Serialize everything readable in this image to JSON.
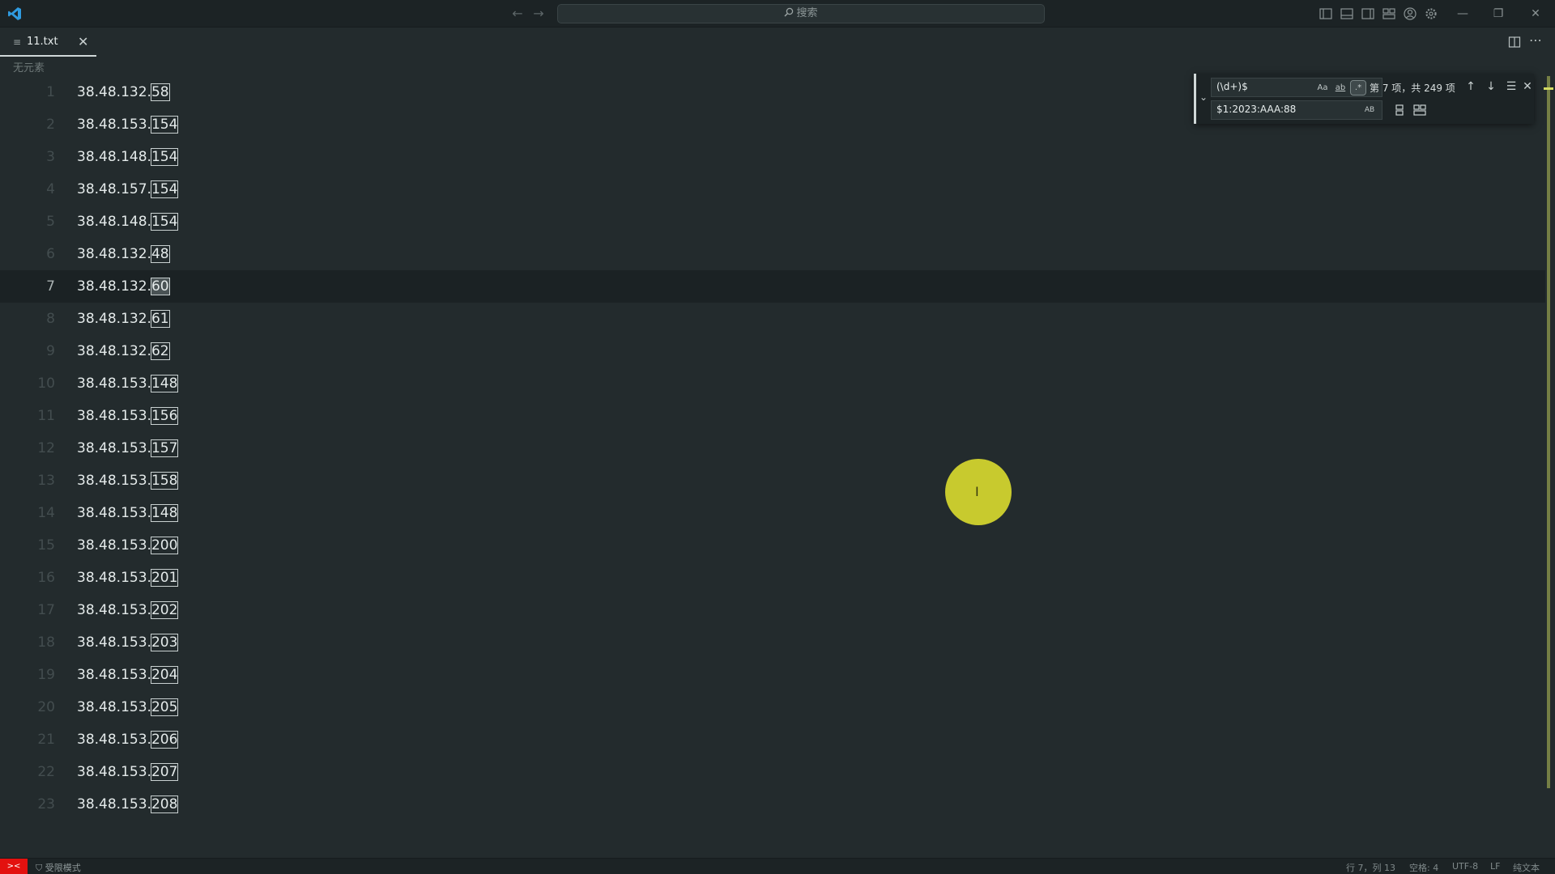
{
  "titlebar": {
    "search_placeholder": "搜索",
    "back": "←",
    "forward": "→",
    "minimize": "—",
    "restore": "❐",
    "close": "✕"
  },
  "tab": {
    "label": "11.txt",
    "close": "✕",
    "icon": "≡"
  },
  "breadcrumb": "无元素",
  "lines": [
    {
      "n": "1",
      "pre": "38.48.132.",
      "match": "58"
    },
    {
      "n": "2",
      "pre": "38.48.153.",
      "match": "154"
    },
    {
      "n": "3",
      "pre": "38.48.148.",
      "match": "154"
    },
    {
      "n": "4",
      "pre": "38.48.157.",
      "match": "154"
    },
    {
      "n": "5",
      "pre": "38.48.148.",
      "match": "154"
    },
    {
      "n": "6",
      "pre": "38.48.132.",
      "match": "48"
    },
    {
      "n": "7",
      "pre": "38.48.132.",
      "match": "60"
    },
    {
      "n": "8",
      "pre": "38.48.132.",
      "match": "61"
    },
    {
      "n": "9",
      "pre": "38.48.132.",
      "match": "62"
    },
    {
      "n": "10",
      "pre": "38.48.153.",
      "match": "148"
    },
    {
      "n": "11",
      "pre": "38.48.153.",
      "match": "156"
    },
    {
      "n": "12",
      "pre": "38.48.153.",
      "match": "157"
    },
    {
      "n": "13",
      "pre": "38.48.153.",
      "match": "158"
    },
    {
      "n": "14",
      "pre": "38.48.153.",
      "match": "148"
    },
    {
      "n": "15",
      "pre": "38.48.153.",
      "match": "200"
    },
    {
      "n": "16",
      "pre": "38.48.153.",
      "match": "201"
    },
    {
      "n": "17",
      "pre": "38.48.153.",
      "match": "202"
    },
    {
      "n": "18",
      "pre": "38.48.153.",
      "match": "203"
    },
    {
      "n": "19",
      "pre": "38.48.153.",
      "match": "204"
    },
    {
      "n": "20",
      "pre": "38.48.153.",
      "match": "205"
    },
    {
      "n": "21",
      "pre": "38.48.153.",
      "match": "206"
    },
    {
      "n": "22",
      "pre": "38.48.153.",
      "match": "207"
    },
    {
      "n": "23",
      "pre": "38.48.153.",
      "match": "208"
    }
  ],
  "current_line": 7,
  "find": {
    "query": "(\\d+)$",
    "match_case": "Aa",
    "whole_word": "ab",
    "regex": ".*",
    "count_text": "第 7 项，共 249 项",
    "prev": "↑",
    "next": "↓",
    "in_selection": "☰",
    "close": "✕",
    "replace_value": "$1:2023:AAA:88",
    "preserve_case": "AB"
  },
  "status": {
    "remote": "><",
    "restricted": "受限模式",
    "position": "行 7，列 13",
    "spaces": "空格: 4",
    "encoding": "UTF-8",
    "eol": "LF",
    "language": "纯文本"
  },
  "colors": {
    "background": "#232b2d",
    "click_indicator": "#c8ca2e",
    "remote_badge": "#e3110f"
  }
}
